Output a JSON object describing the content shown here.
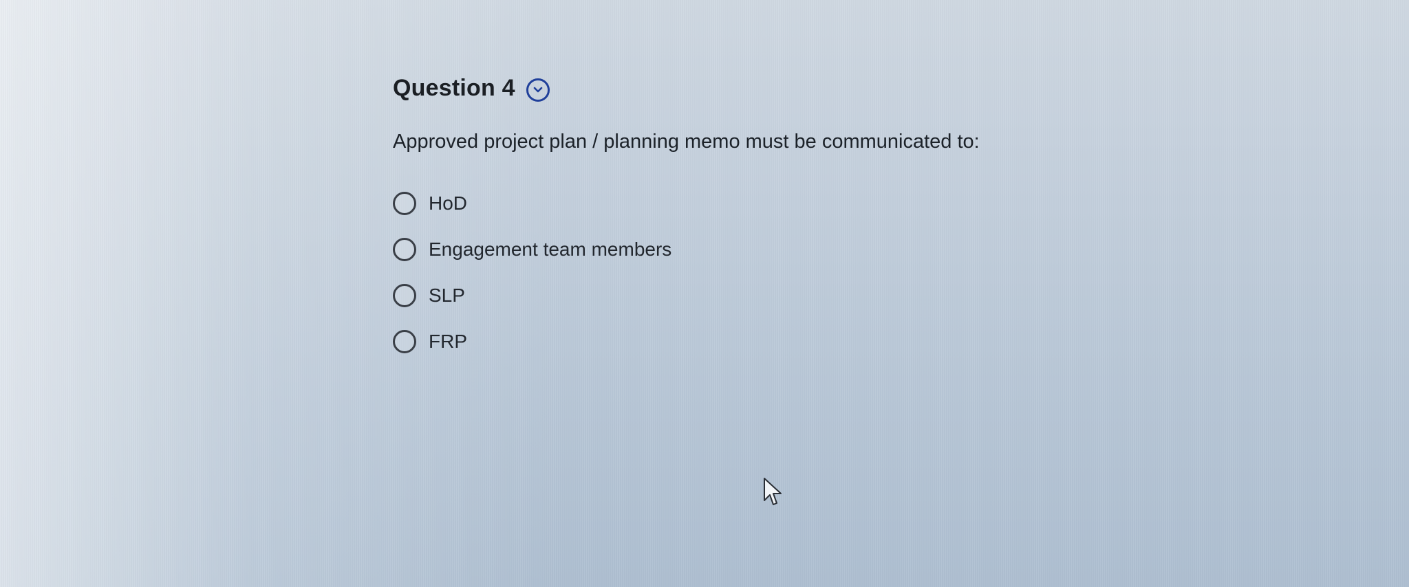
{
  "question": {
    "title": "Question 4",
    "collapse_icon": "chevron-down-circle-icon",
    "text": "Approved project plan / planning memo must be communicated to:",
    "options": [
      {
        "label": "HoD",
        "selected": false
      },
      {
        "label": "Engagement team members",
        "selected": false
      },
      {
        "label": "SLP",
        "selected": false
      },
      {
        "label": "FRP",
        "selected": false
      }
    ]
  },
  "colors": {
    "accent": "#1f3f9a",
    "text": "#1b1f24",
    "radio_border": "#3a3f47"
  },
  "cursor_icon": "mouse-pointer-icon"
}
